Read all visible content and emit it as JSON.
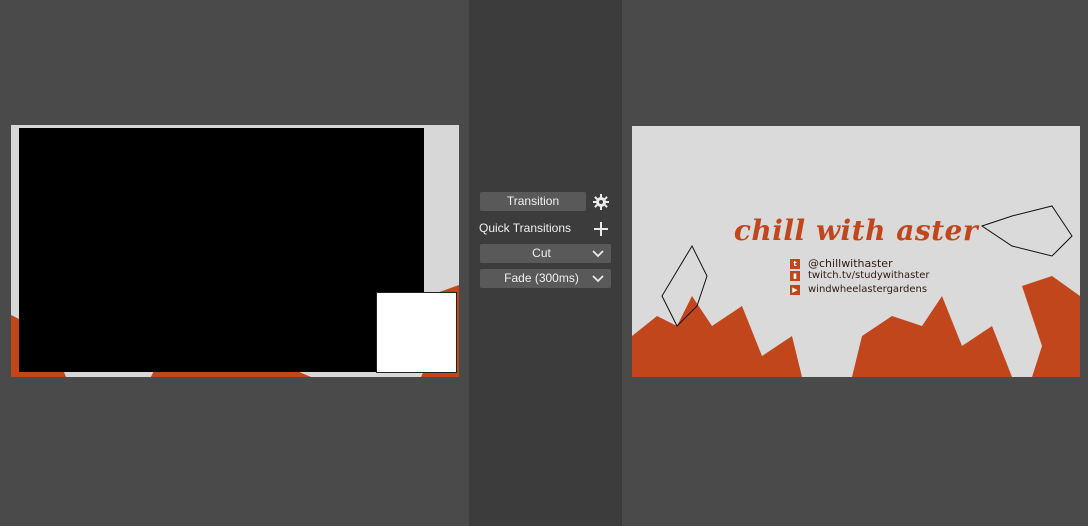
{
  "controls": {
    "transition_button": "Transition",
    "quick_transitions_label": "Quick Transitions",
    "cut_option": "Cut",
    "fade_option": "Fade (300ms)"
  },
  "overlay": {
    "title": "chill with aster",
    "socials": [
      {
        "icon": "twitter-icon",
        "text": "@chillwithaster"
      },
      {
        "icon": "twitch-icon",
        "text": "twitch.tv/studywithaster"
      },
      {
        "icon": "youtube-icon",
        "text": "windwheelastergardens"
      }
    ]
  },
  "colors": {
    "accent_orange": "#c2461c",
    "panel_bg": "#4a4a4a",
    "center_bg": "#3c3c3c",
    "button_bg": "#595959"
  }
}
